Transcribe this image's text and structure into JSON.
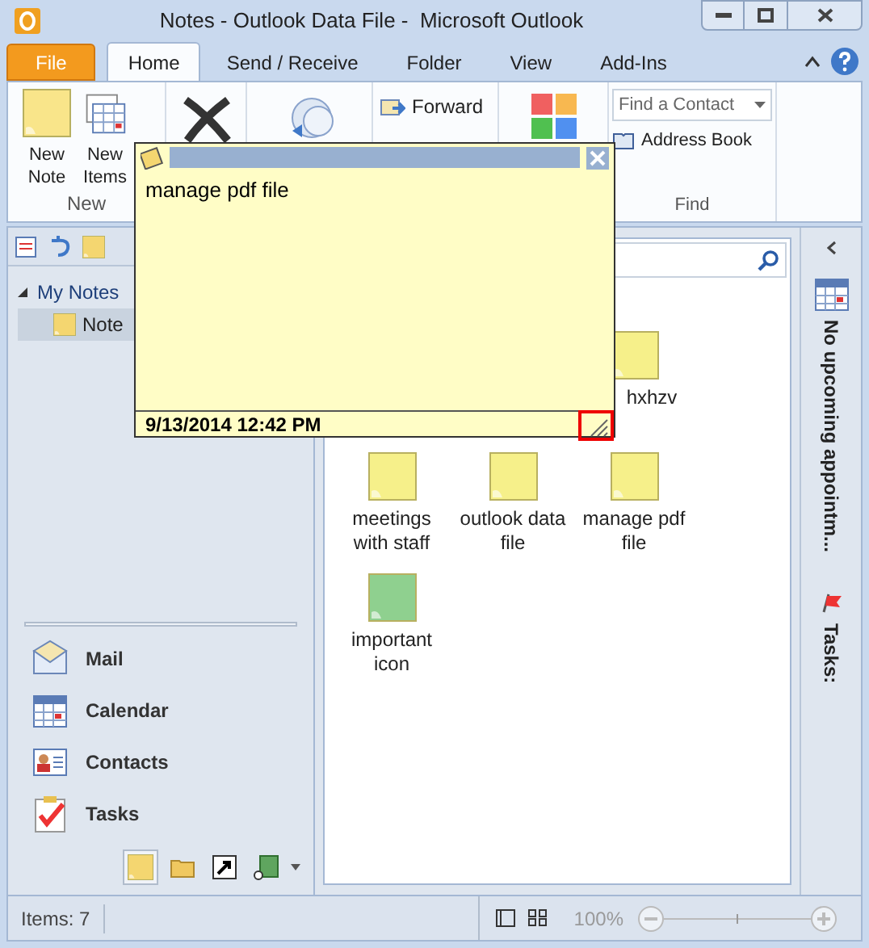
{
  "window": {
    "title": "Notes - Outlook Data File -  Microsoft Outlook"
  },
  "tabs": [
    {
      "label": "File",
      "kind": "file",
      "selected": false
    },
    {
      "label": "Home",
      "kind": "tab",
      "selected": true
    },
    {
      "label": "Send / Receive",
      "kind": "tab",
      "selected": false
    },
    {
      "label": "Folder",
      "kind": "tab",
      "selected": false
    },
    {
      "label": "View",
      "kind": "tab",
      "selected": false
    },
    {
      "label": "Add-Ins",
      "kind": "tab",
      "selected": false
    }
  ],
  "ribbon": {
    "new_group": {
      "label": "New",
      "buttons": [
        "New Note",
        "New Items"
      ]
    },
    "forward": "Forward",
    "find_group": {
      "label": "Find",
      "find_contact": {
        "placeholder": "Find a Contact"
      },
      "address_book": "Address Book"
    }
  },
  "folder_pane": {
    "header": {
      "label": "My Notes",
      "expanded": true
    },
    "folders": [
      {
        "label": "Note",
        "selected": true
      }
    ]
  },
  "navigation": [
    {
      "label": "Mail",
      "kind": "mail"
    },
    {
      "label": "Calendar",
      "kind": "calendar"
    },
    {
      "label": "Contacts",
      "kind": "contacts"
    },
    {
      "label": "Tasks",
      "kind": "tasks"
    }
  ],
  "nav_shortcuts": [
    {
      "kind": "notes",
      "selected": true
    },
    {
      "kind": "folder",
      "selected": false
    },
    {
      "kind": "shortcut",
      "selected": false
    },
    {
      "kind": "journal",
      "selected": false
    }
  ],
  "notes": [
    {
      "label": "hxhzv",
      "color": "#f6f08a"
    },
    {
      "label": "meetings with staff",
      "color": "#f6f08a"
    },
    {
      "label": "outlook data file",
      "color": "#f6f08a"
    },
    {
      "label": "manage pdf file",
      "color": "#f6f08a"
    },
    {
      "label": "important icon",
      "color": "#8fd08f"
    }
  ],
  "todo_bar": {
    "appointments": "No upcoming appointm...",
    "tasks": "Tasks:"
  },
  "open_note": {
    "text": "manage pdf file",
    "timestamp": "9/13/2014 12:42 PM"
  },
  "status_bar": {
    "items": "Items: 7",
    "zoom": "100%",
    "zoom_slider": {
      "level": 0.5
    }
  }
}
